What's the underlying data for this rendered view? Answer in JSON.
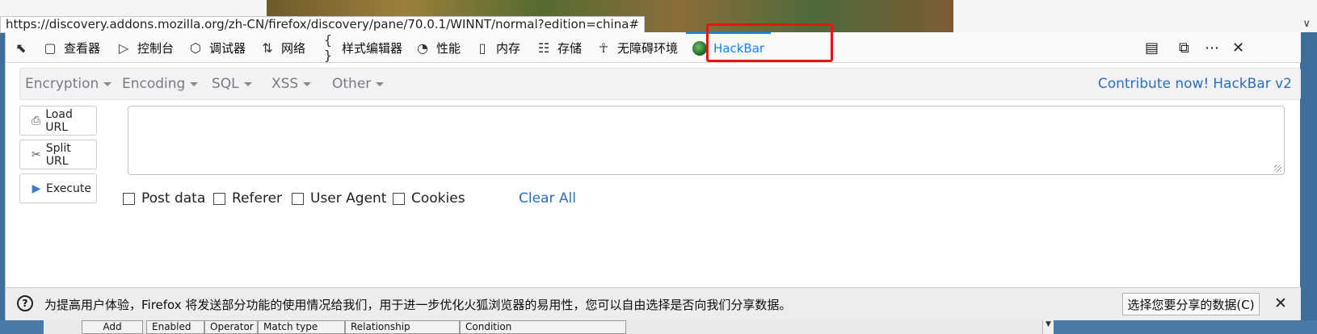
{
  "status_url": "https://discovery.addons.mozilla.org/zh-CN/firefox/discovery/pane/70.0.1/WINNT/normal?edition=china#",
  "devtools": {
    "tabs": [
      {
        "label": "查看器",
        "icon": "inspector-icon"
      },
      {
        "label": "控制台",
        "icon": "console-icon"
      },
      {
        "label": "调试器",
        "icon": "debugger-icon"
      },
      {
        "label": "网络",
        "icon": "network-icon"
      },
      {
        "label": "样式编辑器",
        "icon": "style-editor-icon"
      },
      {
        "label": "性能",
        "icon": "performance-icon"
      },
      {
        "label": "内存",
        "icon": "memory-icon"
      },
      {
        "label": "存储",
        "icon": "storage-icon"
      },
      {
        "label": "无障碍环境",
        "icon": "accessibility-icon"
      },
      {
        "label": "HackBar",
        "icon": "hackbar-icon",
        "active": true
      }
    ]
  },
  "hackbar": {
    "menus": [
      "Encryption",
      "Encoding",
      "SQL",
      "XSS",
      "Other"
    ],
    "contribute": "Contribute now!",
    "version": "HackBar v2",
    "buttons": {
      "load": "Load URL",
      "split": "Split URL",
      "execute": "Execute"
    },
    "url_value": "",
    "options": [
      "Post data",
      "Referer",
      "User Agent",
      "Cookies"
    ],
    "clear_all": "Clear All"
  },
  "notification": {
    "text": "为提高用户体验，Firefox 将发送部分功能的使用情况给我们，用于进一步优化火狐浏览器的易用性，您可以自由选择是否向我们分享数据。",
    "button": "选择您要分享的数据(C)"
  },
  "background_table": {
    "headers": [
      "Add",
      "Enabled",
      "Operator",
      "Match type",
      "Relationship",
      "Condition"
    ]
  },
  "colors": {
    "accent": "#0a84ff",
    "link": "#2a6fbf",
    "highlight": "#ee1111"
  }
}
